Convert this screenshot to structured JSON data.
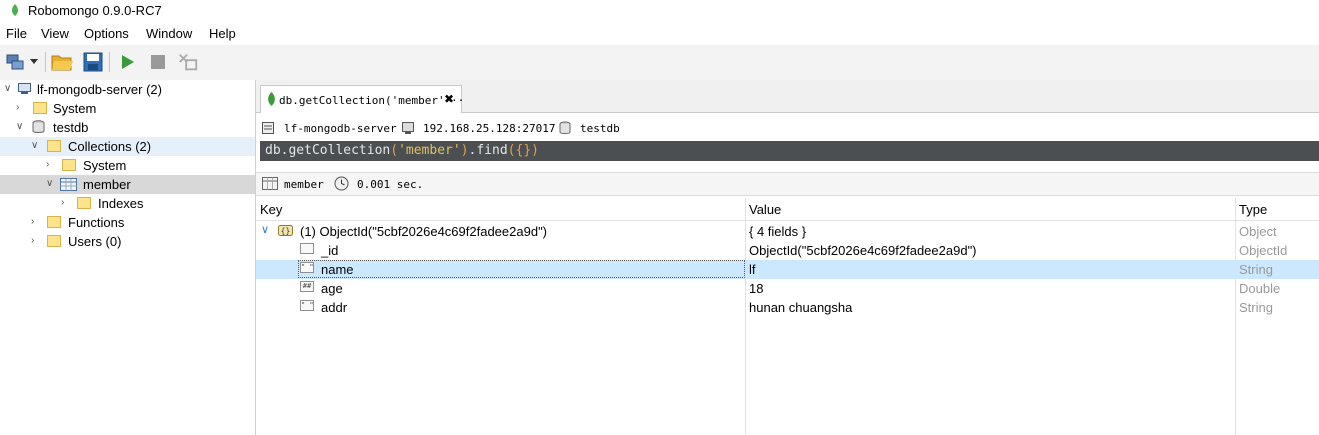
{
  "window": {
    "title": "Robomongo 0.9.0-RC7"
  },
  "menu": [
    "File",
    "View",
    "Options",
    "Window",
    "Help"
  ],
  "toolbar": {
    "icons": [
      "connect-icon",
      "dropdown-icon",
      "open-icon",
      "save-icon",
      "execute-icon",
      "stop-icon",
      "cursor-icon"
    ]
  },
  "tree": {
    "server": "lf-mongodb-server (2)",
    "system": "System",
    "db": "testdb",
    "collections": "Collections (2)",
    "coll_system": "System",
    "member": "member",
    "indexes": "Indexes",
    "functions": "Functions",
    "users": "Users (0)"
  },
  "tab": {
    "label": "db.getCollection('member'···",
    "close": "✖"
  },
  "info": {
    "server": "lf-mongodb-server",
    "host": "192.168.25.128:27017",
    "db": "testdb"
  },
  "query": {
    "text": "db.getCollection('member').find({})"
  },
  "result_bar": {
    "collection": "member",
    "time": "0.001 sec."
  },
  "table": {
    "headers": {
      "key": "Key",
      "value": "Value",
      "type": "Type"
    },
    "rows": [
      {
        "key": "(1) ObjectId(\"5cbf2026e4c69f2fadee2a9d\")",
        "value": "{ 4 fields }",
        "type": "Object"
      },
      {
        "key": "_id",
        "value": "ObjectId(\"5cbf2026e4c69f2fadee2a9d\")",
        "type": "ObjectId"
      },
      {
        "key": "name",
        "value": "lf",
        "type": "String"
      },
      {
        "key": "age",
        "value": "18",
        "type": "Double"
      },
      {
        "key": "addr",
        "value": "hunan chuangsha",
        "type": "String"
      }
    ]
  },
  "colors": {
    "query_bg": "#4b4f52",
    "selection": "#cce8ff",
    "folder": "#ffe38a"
  }
}
